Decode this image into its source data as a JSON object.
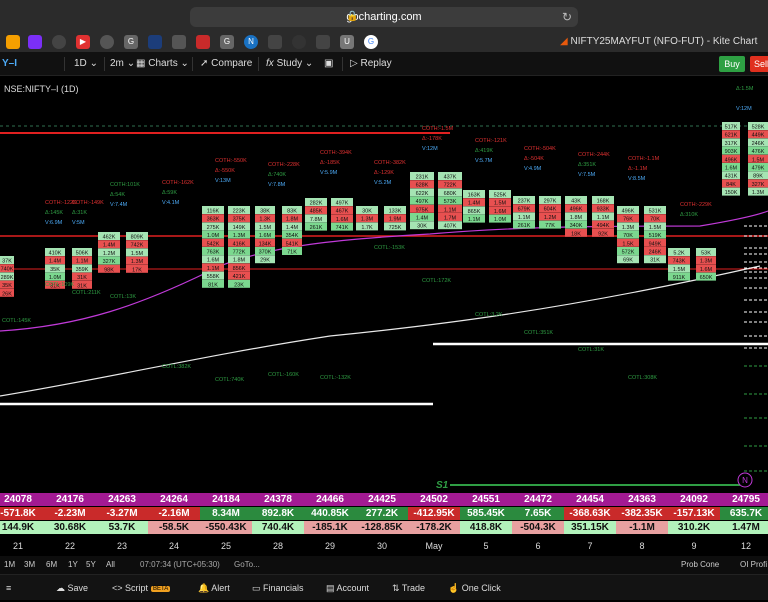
{
  "browser": {
    "url": "gocharting.com",
    "tab_title": "NIFTY25MAYFUT (NFO-FUT) - Kite Chart",
    "bookmark_icons": [
      "orange-bars",
      "purple-app",
      "circle",
      "youtube",
      "dark-circle",
      "G",
      "box",
      "tray",
      "red-banner",
      "G",
      "N",
      "cloud",
      "circle",
      "square",
      "U",
      "google"
    ]
  },
  "toolbar": {
    "symbol_short": "Y–I",
    "interval": "1D",
    "timeframe": "2m",
    "charts_label": "Charts",
    "compare_label": "Compare",
    "study_label": "Study",
    "replay_label": "Replay",
    "buy_label": "Buy",
    "sell_label": "Sell"
  },
  "chart": {
    "symbol_label": "NSE:NIFTY–I (1D)",
    "colors": {
      "bull": "#2f9e44",
      "bear": "#e03131",
      "vwap": "#c03ad8",
      "ma": "#e8e8e8",
      "level": "#e02020"
    },
    "columns": [
      {
        "cot_h": "",
        "delta": "",
        "vol": "",
        "cot_l": "COTL:145K"
      },
      {
        "cot_h": "COTH:-122K",
        "delta": "Δ:145K",
        "vol": "V:6.9M",
        "cot_l": "COTL:109K"
      },
      {
        "cot_h": "COTH:-149K",
        "delta": "Δ:31K",
        "vol": "V:5M",
        "cot_l": "COTL:211K"
      },
      {
        "cot_h": "COTH:101K",
        "delta": "Δ:54K",
        "vol": "V:7.4M",
        "cot_l": "COTL:13K"
      },
      {
        "cot_h": "COTH:-162K",
        "delta": "Δ:59K",
        "vol": "V:4.1M",
        "cot_l": "COTL:382K"
      },
      {
        "cot_h": "COTH:-550K",
        "delta": "Δ:-550K",
        "vol": "V:13M",
        "cot_l": "COTL:740K"
      },
      {
        "cot_h": "COTH:-228K",
        "delta": "Δ:740K",
        "vol": "V:7.8M",
        "cot_l": "COTL:-160K"
      },
      {
        "cot_h": "COTH:-394K",
        "delta": "Δ:-185K",
        "vol": "V:5.9M",
        "cot_l": "COTL:-132K"
      },
      {
        "cot_h": "COTH:-382K",
        "delta": "Δ:-129K",
        "vol": "V:5.2M",
        "cot_l": "COTL:-153K"
      },
      {
        "cot_h": "COTH:-1.5M",
        "delta": "Δ:-178K",
        "vol": "V:12M",
        "cot_l": "COTL:172K"
      },
      {
        "cot_h": "COTH:-121K",
        "delta": "Δ:419K",
        "vol": "V:5.7M",
        "cot_l": "COTL:3.2K"
      },
      {
        "cot_h": "COTH:-504K",
        "delta": "Δ:-504K",
        "vol": "V:4.9M",
        "cot_l": "COTL:351K"
      },
      {
        "cot_h": "COTH:-244K",
        "delta": "Δ:351K",
        "vol": "V:7.5M",
        "cot_l": "COTL:31K"
      },
      {
        "cot_h": "COTH:-1.1M",
        "delta": "Δ:-1.1M",
        "vol": "V:8.5M",
        "cot_l": "COTL:308K"
      },
      {
        "cot_h": "COTH:-229K",
        "delta": "Δ:310K",
        "vol": "",
        "cot_l": ""
      },
      {
        "cot_h": "Δ:1.5M",
        "delta": "",
        "vol": "V:12M",
        "cot_l": ""
      }
    ],
    "footprint_values": [
      [
        "37K",
        "740K",
        "289K",
        "35K",
        "26K"
      ],
      [
        "410K",
        "1.4M",
        "35K",
        "1.0M",
        "31K"
      ],
      [
        "506K",
        "1.1M",
        "359K",
        "31K",
        "31K"
      ],
      [
        "462K",
        "1.4M",
        "1.2M",
        "327K",
        "98K"
      ],
      [
        "809K",
        "742K",
        "1.5M",
        "1.3M",
        "17K"
      ],
      [
        "116K",
        "363K",
        "275K",
        "1.0M",
        "542K",
        "763K",
        "1.6M",
        "1.1M",
        "558K",
        "81K"
      ],
      [
        "223K",
        "375K",
        "149K",
        "1.3M",
        "416K",
        "772K",
        "1.8M",
        "856K",
        "421K",
        "23K"
      ],
      [
        "38K",
        "1.3K",
        "1.5M",
        "1.6M",
        "134K",
        "370K",
        "29K"
      ],
      [
        "83K",
        "1.8M",
        "1.4M",
        "354K",
        "541K",
        "71K"
      ],
      [
        "282K",
        "485K",
        "7.8M",
        "261K"
      ],
      [
        "497K",
        "467K",
        "1.6M",
        "741K"
      ],
      [
        "30K",
        "1.3M",
        "1.7K"
      ],
      [
        "133K",
        "1.9M",
        "725K"
      ],
      [
        "231K",
        "628K",
        "622K",
        "497K",
        "975K",
        "1.4M",
        "30K"
      ],
      [
        "437K",
        "722K",
        "680K",
        "573K",
        "1.1M",
        "1.7M",
        "407K"
      ],
      [
        "163K",
        "1.4M",
        "865K",
        "1.1M"
      ],
      [
        "525K",
        "1.5M",
        "1.6M",
        "1.0M"
      ],
      [
        "237K",
        "679K",
        "1.1M",
        "261K"
      ],
      [
        "297K",
        "604K",
        "1.2M",
        "77K"
      ],
      [
        "43K",
        "496K",
        "1.8M",
        "340K",
        "18K"
      ],
      [
        "168K",
        "933K",
        "1.1M",
        "494K",
        "92K"
      ],
      [
        "496K",
        "76K",
        "1.3M",
        "70K",
        "1.5K",
        "572K",
        "69K"
      ],
      [
        "531K",
        "70K",
        "1.5M",
        "519K",
        "949K",
        "246K",
        "31K"
      ],
      [
        "5.2K",
        "743K",
        "1.5M",
        "911K"
      ],
      [
        "53K",
        "1.3M",
        "1.6M",
        "650K"
      ],
      [
        "517K",
        "621K",
        "317K",
        "903K",
        "496K",
        "1.6M",
        "431K",
        "84K",
        "150K"
      ],
      [
        "528K",
        "449K",
        "246K",
        "476K",
        "1.5M",
        "479K",
        "89K",
        "327K",
        "1.3M"
      ]
    ]
  },
  "table_rows": {
    "prices": [
      "24078",
      "24176",
      "24263",
      "24264",
      "24184",
      "24378",
      "24466",
      "24425",
      "24502",
      "24551",
      "24472",
      "24454",
      "24363",
      "24092",
      "24795"
    ],
    "changes": [
      "-571.8K",
      "-2.23M",
      "-3.27M",
      "-2.16M",
      "8.34M",
      "892.8K",
      "440.85K",
      "277.2K",
      "-412.95K",
      "585.45K",
      "7.65K",
      "-368.63K",
      "-382.35K",
      "-157.13K",
      "635.7K"
    ],
    "deltas": [
      "144.9K",
      "30.68K",
      "53.7K",
      "-58.5K",
      "-550.43K",
      "740.4K",
      "-185.1K",
      "-128.85K",
      "-178.2K",
      "418.8K",
      "-504.3K",
      "351.15K",
      "-1.1M",
      "310.2K",
      "1.47M"
    ],
    "dates": [
      "21",
      "22",
      "23",
      "24",
      "25",
      "28",
      "29",
      "30",
      "May",
      "5",
      "6",
      "7",
      "8",
      "9",
      "12"
    ]
  },
  "chart_markers": {
    "s1_label": "S1",
    "n_badge": "N"
  },
  "ranges": {
    "items": [
      "1M",
      "3M",
      "6M",
      "1Y",
      "5Y",
      "All"
    ],
    "time": "07:07:34 (UTC+05:30)",
    "goto": "GoTo...",
    "prob_cone": "Prob Cone",
    "oi_profile": "OI Profi"
  },
  "footer": {
    "save": "Save",
    "script": "Script",
    "beta": "BETA",
    "alert": "Alert",
    "financials": "Financials",
    "account": "Account",
    "trade": "Trade",
    "one_click": "One Click"
  }
}
